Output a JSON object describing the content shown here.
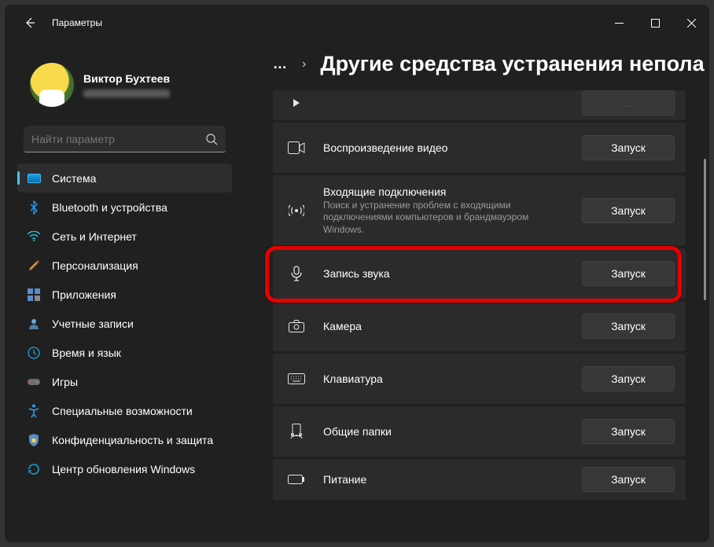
{
  "window": {
    "title": "Параметры"
  },
  "profile": {
    "name": "Виктор Бухтеев"
  },
  "search": {
    "placeholder": "Найти параметр"
  },
  "sidebar": {
    "items": [
      {
        "label": "Система"
      },
      {
        "label": "Bluetooth и устройства"
      },
      {
        "label": "Сеть и Интернет"
      },
      {
        "label": "Персонализация"
      },
      {
        "label": "Приложения"
      },
      {
        "label": "Учетные записи"
      },
      {
        "label": "Время и язык"
      },
      {
        "label": "Игры"
      },
      {
        "label": "Специальные возможности"
      },
      {
        "label": "Конфиденциальность и защита"
      },
      {
        "label": "Центр обновления Windows"
      }
    ]
  },
  "header": {
    "ellipsis": "…",
    "chevron": "›",
    "title": "Другие средства устранения непола"
  },
  "buttons": {
    "run": "Запуск"
  },
  "rows": [
    {
      "title": "Воспроизведение видео",
      "desc": ""
    },
    {
      "title": "Входящие подключения",
      "desc": "Поиск и устранение проблем с входящими подключениями компьютеров и брандмауэром Windows."
    },
    {
      "title": "Запись звука",
      "desc": ""
    },
    {
      "title": "Камера",
      "desc": ""
    },
    {
      "title": "Клавиатура",
      "desc": ""
    },
    {
      "title": "Общие папки",
      "desc": ""
    },
    {
      "title": "Питание",
      "desc": ""
    }
  ]
}
